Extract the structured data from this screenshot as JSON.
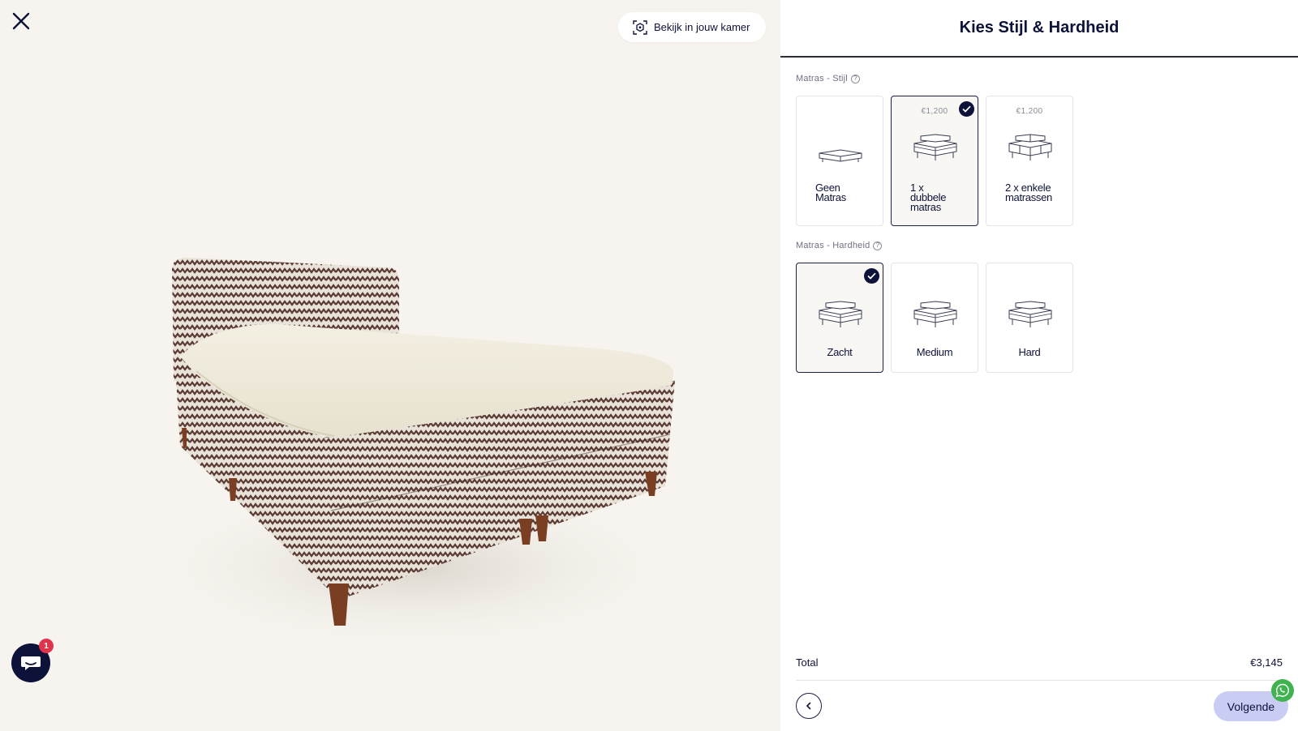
{
  "viewer": {
    "ar_button_label": "Bekijk in jouw kamer",
    "chat_badge_count": "1",
    "icons": {
      "close": "close-icon",
      "ar": "ar-view-icon",
      "chat": "chat-icon"
    }
  },
  "panel": {
    "title": "Kies Stijl & Hardheid",
    "style_section": {
      "label": "Matras - Stijl",
      "options": [
        {
          "label_lines": [
            "Geen",
            "Matras"
          ],
          "price": "",
          "selected": false
        },
        {
          "label_lines": [
            "1 x",
            "dubbele",
            "matras"
          ],
          "price": "€1,200",
          "selected": true
        },
        {
          "label_lines": [
            "2 x enkele",
            "matrassen"
          ],
          "price": "€1,200",
          "selected": false
        }
      ]
    },
    "firmness_section": {
      "label": "Matras - Hardheid",
      "options": [
        {
          "label": "Zacht",
          "selected": true
        },
        {
          "label": "Medium",
          "selected": false
        },
        {
          "label": "Hard",
          "selected": false
        }
      ]
    },
    "footer": {
      "total_label": "Total",
      "total_value": "€3,145",
      "next_label": "Volgende"
    }
  },
  "colors": {
    "navy": "#0d1238",
    "viewer_bg": "#f7f4ef",
    "next_button_bg": "#c9cdf4",
    "badge_red": "#e0344d",
    "whatsapp_green": "#3fb34f"
  }
}
